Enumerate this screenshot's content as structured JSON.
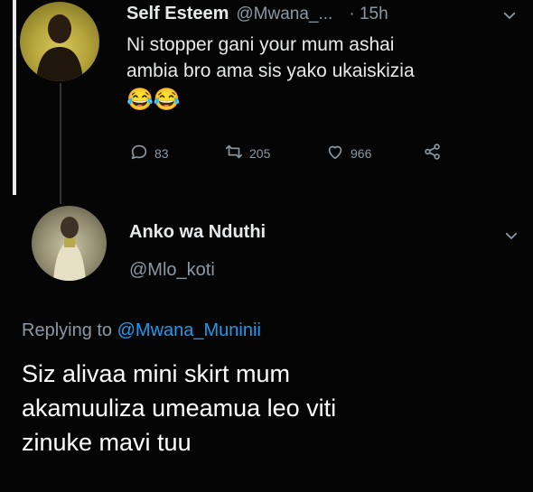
{
  "parent_tweet": {
    "display_name": "Self Esteem",
    "handle": "@Mwana_...",
    "time": "· 15h",
    "text_line1": "Ni stopper gani your mum ashai",
    "text_line2": "ambia bro ama sis yako ukaiskizia",
    "emoji": "😂😂",
    "actions": {
      "replies": "83",
      "retweets": "205",
      "likes": "966"
    }
  },
  "reply_tweet": {
    "display_name": "Anko wa Nduthi",
    "handle": "@Mlo_koti",
    "replying_prefix": "Replying to",
    "replying_handle": "@Mwana_Muninii",
    "text_line1": "Siz alivaa mini skirt mum",
    "text_line2": "akamuuliza umeamua leo viti",
    "text_line3": "zinuke mavi tuu"
  },
  "colors": {
    "background": "#050505",
    "text": "#e7e9ea",
    "muted": "#8b98a5",
    "link": "#1d9bf0"
  }
}
